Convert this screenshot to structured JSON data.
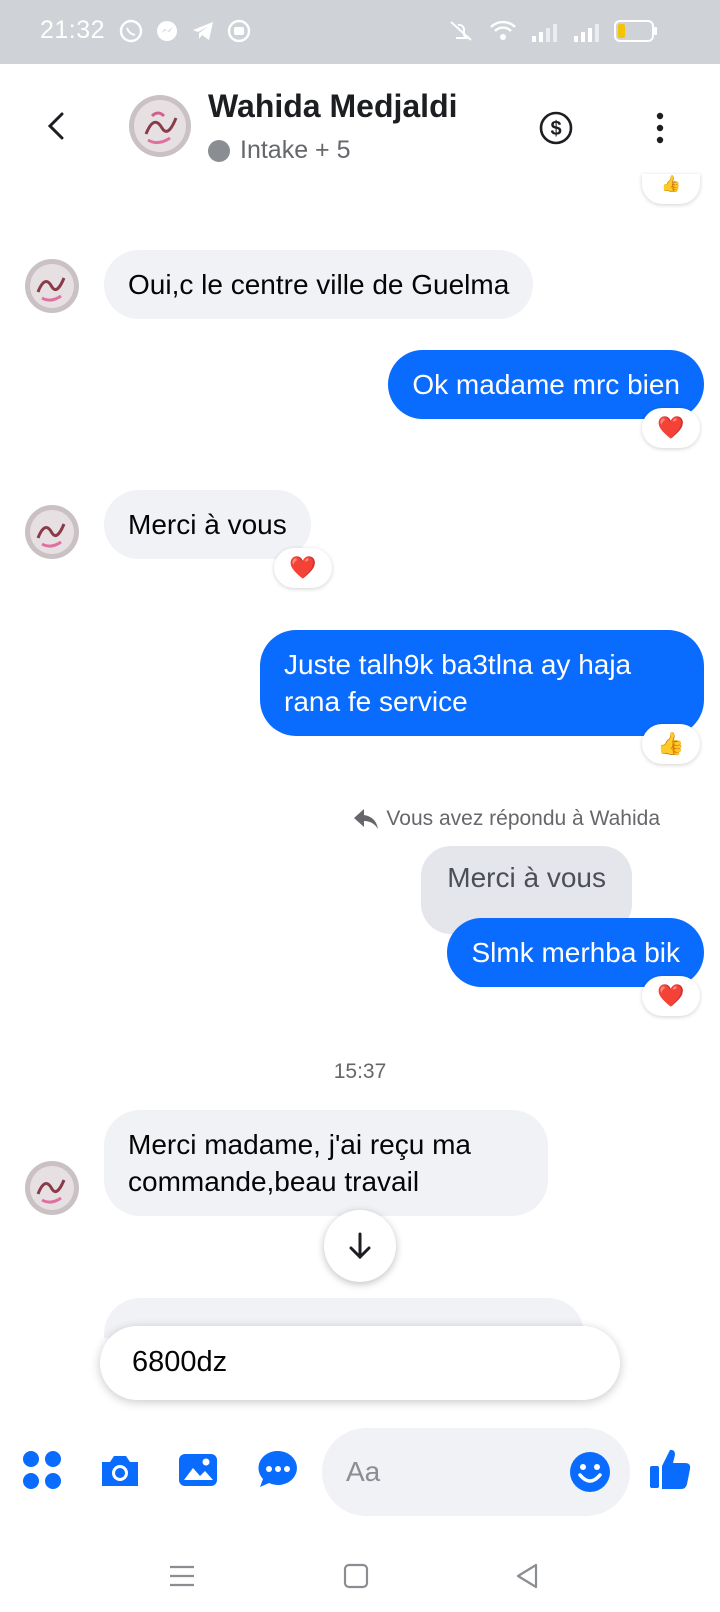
{
  "status_bar": {
    "time": "21:32"
  },
  "header": {
    "contact_name": "Wahida Medjaldi",
    "subtitle": "Intake + 5"
  },
  "messages": [
    {
      "direction": "incoming",
      "text": "Oui,c le centre ville de Guelma"
    },
    {
      "direction": "outgoing",
      "text": "Ok madame mrc bien",
      "reaction": "❤️"
    },
    {
      "direction": "incoming",
      "text": "Merci à vous",
      "reaction": "❤️"
    },
    {
      "direction": "outgoing",
      "text_line1": "Juste talh9k ba3tlna ay haja",
      "text_line2": "rana fe service",
      "reaction": "👍"
    },
    {
      "direction": "outgoing",
      "reply_note": "Vous avez répondu à Wahida",
      "quoted": "Merci à vous",
      "text": "Slmk merhba bik",
      "reaction": "❤️"
    },
    {
      "direction": "incoming",
      "text_line1": "Merci madame, j'ai reçu  ma",
      "text_line2": "commande,beau travail"
    }
  ],
  "timestamp": "15:37",
  "suggestion": "6800dz",
  "composer": {
    "placeholder": "Aa"
  },
  "colors": {
    "accent": "#0a6bff",
    "incoming_bubble": "#f0f2f5"
  }
}
